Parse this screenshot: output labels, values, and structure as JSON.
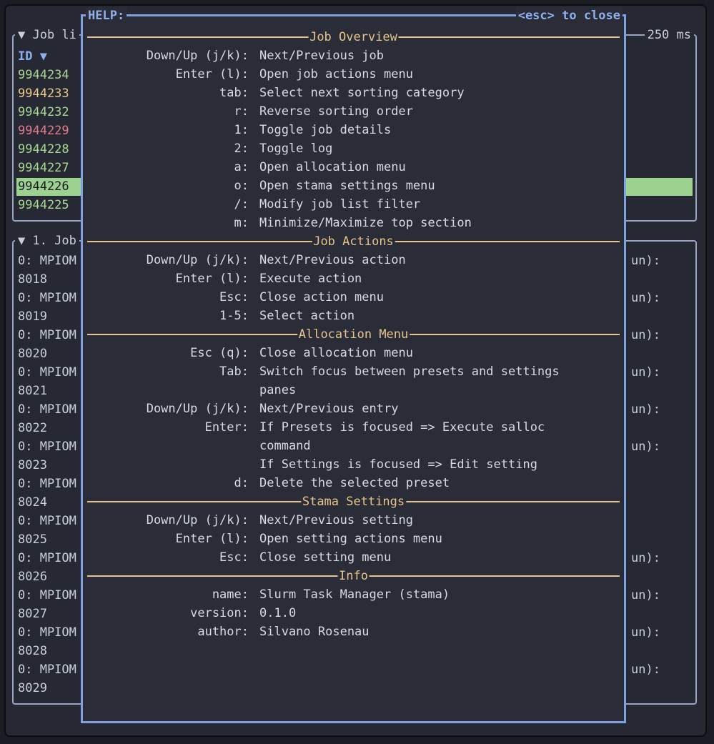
{
  "top_panel": {
    "title": "▼ Job li",
    "refresh": "250 ms",
    "header": "ID ▼",
    "jobs": [
      {
        "id": "9944234",
        "color": "#a8d890"
      },
      {
        "id": "9944233",
        "color": "#eac989"
      },
      {
        "id": "9944232",
        "color": "#a8d890"
      },
      {
        "id": "9944229",
        "color": "#e27a8c"
      },
      {
        "id": "9944228",
        "color": "#a8d890"
      },
      {
        "id": "9944227",
        "color": "#a8d890"
      },
      {
        "id": "9944226",
        "color": "#1b1d24",
        "selected": true
      },
      {
        "id": "9944225",
        "color": "#a8d890"
      }
    ],
    "selected_bg": "#9cd18f"
  },
  "bottom_panel": {
    "title": "▼ 1. Job",
    "lines": [
      {
        "left": "0: MPIOM",
        "right": "un):"
      },
      {
        "left": "8018",
        "right": ""
      },
      {
        "left": "0: MPIOM",
        "right": "un):"
      },
      {
        "left": "8019",
        "right": ""
      },
      {
        "left": "0: MPIOM",
        "right": "un):"
      },
      {
        "left": "8020",
        "right": ""
      },
      {
        "left": "0: MPIOM",
        "right": "un):"
      },
      {
        "left": "8021",
        "right": ""
      },
      {
        "left": "0: MPIOM",
        "right": "un):"
      },
      {
        "left": "8022",
        "right": ""
      },
      {
        "left": "0: MPIOM",
        "right": "un):"
      },
      {
        "left": "8023",
        "right": ""
      },
      {
        "left": "0: MPIOM",
        "right": ""
      },
      {
        "left": "8024",
        "right": ""
      },
      {
        "left": "0: MPIOM",
        "right": ""
      },
      {
        "left": "8025",
        "right": ""
      },
      {
        "left": "0: MPIOM",
        "right": "un):"
      },
      {
        "left": "8026",
        "right": ""
      },
      {
        "left": "0: MPIOM",
        "right": "un):"
      },
      {
        "left": "8027",
        "right": ""
      },
      {
        "left": "0: MPIOM",
        "right": "un):"
      },
      {
        "left": "8028",
        "right": ""
      },
      {
        "left": "0: MPIOM",
        "right": "un):"
      },
      {
        "left": "8029",
        "right": ""
      }
    ]
  },
  "help": {
    "title": "HELP:",
    "close_hint": "<esc> to close",
    "sections": [
      {
        "title": "Job Overview",
        "rows": [
          {
            "key": "Down/Up (j/k):",
            "desc": "Next/Previous job"
          },
          {
            "key": "Enter (l):",
            "desc": "Open job actions menu"
          },
          {
            "key": "tab:",
            "desc": "Select next sorting category"
          },
          {
            "key": "r:",
            "desc": "Reverse sorting order"
          },
          {
            "key": "1:",
            "desc": "Toggle job details"
          },
          {
            "key": "2:",
            "desc": "Toggle log"
          },
          {
            "key": "a:",
            "desc": "Open allocation menu"
          },
          {
            "key": "o:",
            "desc": "Open stama settings menu"
          },
          {
            "key": "/:",
            "desc": "Modify job list filter"
          },
          {
            "key": "m:",
            "desc": "Minimize/Maximize top section"
          }
        ]
      },
      {
        "title": "Job Actions",
        "rows": [
          {
            "key": "Down/Up (j/k):",
            "desc": "Next/Previous action"
          },
          {
            "key": "Enter (l):",
            "desc": "Execute action"
          },
          {
            "key": "Esc:",
            "desc": "Close action menu"
          },
          {
            "key": "1-5:",
            "desc": "Select action"
          }
        ]
      },
      {
        "title": "Allocation Menu",
        "rows": [
          {
            "key": "Esc (q):",
            "desc": "Close allocation menu"
          },
          {
            "key": "Tab:",
            "desc": "Switch focus between presets and settings"
          },
          {
            "key": "",
            "desc": "panes"
          },
          {
            "key": "Down/Up (j/k):",
            "desc": "Next/Previous entry"
          },
          {
            "key": "Enter:",
            "desc": "If Presets is focused => Execute salloc"
          },
          {
            "key": "",
            "desc": "command"
          },
          {
            "key": "",
            "desc": "If Settings is focused => Edit setting"
          },
          {
            "key": "d:",
            "desc": "Delete the selected preset"
          }
        ]
      },
      {
        "title": "Stama Settings",
        "rows": [
          {
            "key": "Down/Up (j/k):",
            "desc": "Next/Previous setting"
          },
          {
            "key": "Enter (l):",
            "desc": "Open setting actions menu"
          },
          {
            "key": "Esc:",
            "desc": "Close setting menu"
          }
        ]
      },
      {
        "title": "Info",
        "rows": [
          {
            "key": "name:",
            "desc": "Slurm Task Manager (stama)"
          },
          {
            "key": "version:",
            "desc": "0.1.0"
          },
          {
            "key": "author:",
            "desc": "Silvano Rosenau"
          }
        ]
      }
    ]
  },
  "colors": {
    "accent": "#7fa1e0",
    "section": "#e6c58c",
    "text": "#d6dae3",
    "header": "#8fb0ec"
  }
}
